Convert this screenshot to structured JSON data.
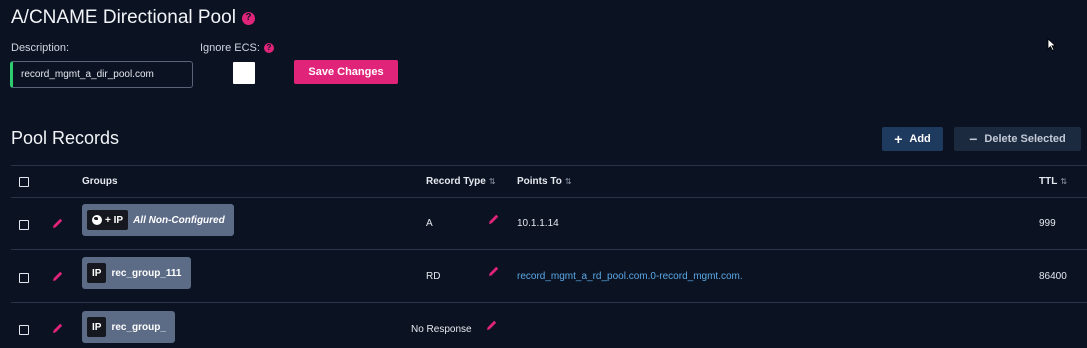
{
  "header": {
    "title": "A/CNAME Directional Pool",
    "help_icon": "?"
  },
  "form": {
    "description_label": "Description:",
    "description_value": "record_mgmt_a_dir_pool.com",
    "ignore_ecs_label": "Ignore ECS:",
    "ignore_ecs_checked": false,
    "save_label": "Save Changes"
  },
  "pool": {
    "title": "Pool Records",
    "add_label": "Add",
    "delete_label": "Delete Selected",
    "columns": {
      "groups": "Groups",
      "record_type": "Record Type",
      "points_to": "Points To",
      "ttl": "TTL"
    },
    "rows": [
      {
        "group_tag": "+ IP",
        "group_name": "All Non-Configured",
        "record_type": "A",
        "points_to": "10.1.1.14",
        "ttl": "999"
      },
      {
        "group_tag": "IP",
        "group_name": "rec_group_111",
        "record_type": "RD",
        "points_to": "record_mgmt_a_rd_pool.com.0-record_mgmt.com.",
        "ttl": "86400"
      },
      {
        "group_tag": "IP",
        "group_name": "rec_group_",
        "record_type": "No Response",
        "points_to": "",
        "ttl": ""
      }
    ]
  },
  "colors": {
    "accent": "#e0247a",
    "background": "#0b1222",
    "link": "#5aa9e6",
    "chip": "#5c6b86",
    "button_primary": "#1e3a5f"
  }
}
